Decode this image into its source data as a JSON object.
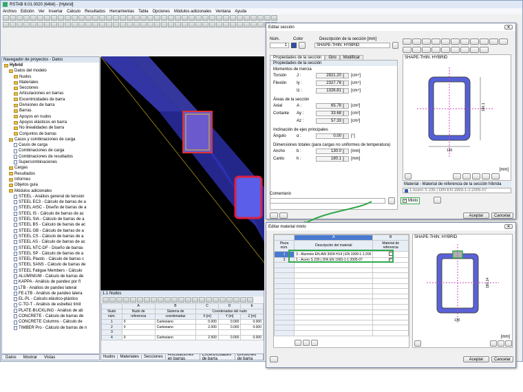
{
  "main_window": {
    "title": "RSTAB 8.01.0020 (64bit) - [Hybrid]",
    "menu": [
      "Archivo",
      "Edición",
      "Ver",
      "Insertar",
      "Cálculo",
      "Resultados",
      "Herramientas",
      "Tabla",
      "Opciones",
      "Módulos adicionales",
      "Ventana",
      "Ayuda"
    ]
  },
  "navigator": {
    "title": "Navegador de proyectos - Datos",
    "root": "Hybrid",
    "items": [
      {
        "label": "Datos del modelo",
        "level": 1,
        "kind": "folder"
      },
      {
        "label": "Nudos",
        "level": 2,
        "kind": "folder"
      },
      {
        "label": "Materiales",
        "level": 2,
        "kind": "folder"
      },
      {
        "label": "Secciones",
        "level": 2,
        "kind": "folder"
      },
      {
        "label": "Articulaciones en barras",
        "level": 2,
        "kind": "folder"
      },
      {
        "label": "Excentricidades de barra",
        "level": 2,
        "kind": "folder"
      },
      {
        "label": "Divisiones de barra",
        "level": 2,
        "kind": "folder"
      },
      {
        "label": "Barras",
        "level": 2,
        "kind": "folder"
      },
      {
        "label": "Apoyos en nudos",
        "level": 2,
        "kind": "folder"
      },
      {
        "label": "Apoyos elásticos en barra",
        "level": 2,
        "kind": "folder"
      },
      {
        "label": "No linealidades de barra",
        "level": 2,
        "kind": "folder"
      },
      {
        "label": "Conjuntos de barras",
        "level": 2,
        "kind": "folder"
      },
      {
        "label": "Casos y combinaciones de carga",
        "level": 1,
        "kind": "folder"
      },
      {
        "label": "Casos de carga",
        "level": 2,
        "kind": "doc"
      },
      {
        "label": "Combinaciones de carga",
        "level": 2,
        "kind": "doc"
      },
      {
        "label": "Combinaciones de resultados",
        "level": 2,
        "kind": "doc"
      },
      {
        "label": "Supercombinaciones",
        "level": 2,
        "kind": "doc"
      },
      {
        "label": "Cargas",
        "level": 1,
        "kind": "folder"
      },
      {
        "label": "Resultados",
        "level": 1,
        "kind": "folder"
      },
      {
        "label": "Informes",
        "level": 1,
        "kind": "folder"
      },
      {
        "label": "Objetos guía",
        "level": 1,
        "kind": "folder"
      },
      {
        "label": "Módulos adicionales",
        "level": 1,
        "kind": "folder"
      },
      {
        "label": "STEEL - Análisis general de tension",
        "level": 2,
        "kind": "doc"
      },
      {
        "label": "STEEL EC3 - Cálculo de barras de a",
        "level": 2,
        "kind": "doc"
      },
      {
        "label": "STEEL AISC - Diseño de barras de a",
        "level": 2,
        "kind": "doc"
      },
      {
        "label": "STEEL IS - Cálculo de barras de ac",
        "level": 2,
        "kind": "doc"
      },
      {
        "label": "STEEL SIA - Cálculo de barras de a",
        "level": 2,
        "kind": "doc"
      },
      {
        "label": "STEEL BS - Cálculo de barras de ac",
        "level": 2,
        "kind": "doc"
      },
      {
        "label": "STEEL GB - Cálculo de barras de a",
        "level": 2,
        "kind": "doc"
      },
      {
        "label": "STEEL CS - Cálculo de barras de a",
        "level": 2,
        "kind": "doc"
      },
      {
        "label": "STEEL AS - Cálculo de barras de ac",
        "level": 2,
        "kind": "doc"
      },
      {
        "label": "STEEL NTC-DF - Diseño de barras",
        "level": 2,
        "kind": "doc"
      },
      {
        "label": "STEEL SP - Cálculo de barras de a",
        "level": 2,
        "kind": "doc"
      },
      {
        "label": "STEEL Plastic - Cálculo de barras c",
        "level": 2,
        "kind": "doc"
      },
      {
        "label": "STEEL SANS - Cálculo de barras de",
        "level": 2,
        "kind": "doc"
      },
      {
        "label": "STEEL Fatigue Members - Cálculo",
        "level": 2,
        "kind": "doc"
      },
      {
        "label": "ALUMINIUM - Cálculo de barras de",
        "level": 2,
        "kind": "doc"
      },
      {
        "label": "KAPPA - Análisis de pandeo por fl",
        "level": 2,
        "kind": "doc"
      },
      {
        "label": "LTB - Análisis de pandeo lateral",
        "level": 2,
        "kind": "doc"
      },
      {
        "label": "FE-LTB - Análisis de pandeo latera",
        "level": 2,
        "kind": "doc"
      },
      {
        "label": "EL-PL - Cálculo elástico-plástico",
        "level": 2,
        "kind": "doc"
      },
      {
        "label": "C-TO-T - Análisis de esbeltez limit",
        "level": 2,
        "kind": "doc"
      },
      {
        "label": "PLATE-BUCKLING - Análisis de ab",
        "level": 2,
        "kind": "doc"
      },
      {
        "label": "CONCRETE - Cálculo de barras de",
        "level": 2,
        "kind": "doc"
      },
      {
        "label": "CONCRETE Columns - Cálculo de",
        "level": 2,
        "kind": "doc"
      },
      {
        "label": "TIMBER Pro - Cálculo de barras de n",
        "level": 2,
        "kind": "doc"
      }
    ],
    "tabs": [
      "Datos",
      "Mostrar",
      "Vistas"
    ]
  },
  "table_panel": {
    "title": "1.1 Nudos",
    "headers_letters": [
      "A",
      "B",
      "C",
      "D",
      "E"
    ],
    "headers_row1": [
      "Nudo",
      "Nudo de",
      "Sistema de",
      "Coordenadas del nudo",
      "",
      ""
    ],
    "headers_row2": [
      "núm.",
      "referencia",
      "coordenadas",
      "X [m]",
      "Y [m]",
      "Z [m]"
    ],
    "rows": [
      [
        "1",
        "0",
        "Cartesiano",
        "0.000",
        "0.000",
        "0.000"
      ],
      [
        "2",
        "0",
        "Cartesiano",
        "2.000",
        "0.000",
        "0.000"
      ],
      [
        "3",
        "",
        "",
        "",
        "",
        ""
      ],
      [
        "4",
        "0",
        "Cartesiano",
        "2.500",
        "0.000",
        "0.000"
      ]
    ],
    "tabs": [
      "Nudos",
      "Materiales",
      "Secciones",
      "Articulaciones en barras",
      "Excentricidades de barra",
      "Divisiones de barra"
    ]
  },
  "section_dialog": {
    "title": "Editar sección",
    "num_label": "Núm.",
    "color_label": "Color",
    "desc_label": "Descripción de la sección [mm]",
    "num": "1",
    "desc": "SHAPE-THIN: HYBRID",
    "tabs": [
      "Propiedades de la sección",
      "Giro",
      "Modificar"
    ],
    "props_title": "Propiedades de la sección",
    "inertia_title": "Momentos de inercia",
    "torsion_label": "Torsión",
    "torsion_sym": "J :",
    "torsion_val": "2821.20",
    "torsion_unit": "[cm⁴]",
    "flex_label": "Flexión",
    "iy_sym": "Iy :",
    "iy_val": "2327.78",
    "iy_unit": "[cm⁴]",
    "iz_sym": "Iz :",
    "iz_val": "1326.81",
    "iz_unit": "[cm⁴]",
    "area_title": "Áreas de la sección",
    "axial_label": "Axial",
    "a_sym": "A :",
    "a_val": "65.78",
    "a_unit": "[cm²]",
    "shear_label": "Cortante",
    "ay_sym": "Ay :",
    "ay_val": "33.68",
    "ay_unit": "[cm²]",
    "az_sym": "Az :",
    "az_val": "57.33",
    "az_unit": "[cm²]",
    "incl_title": "Inclinación de ejes principales",
    "angle_label": "Ángulo",
    "angle_sym": "α :",
    "angle_val": "0.00",
    "angle_unit": "[°]",
    "dims_title": "Dimensiones totales (para cargas no uniformes de temperatura)",
    "width_label": "Ancho",
    "width_sym": "b :",
    "width_val": "130.0",
    "width_unit": "[mm]",
    "height_label": "Canto",
    "height_sym": "h :",
    "height_val": "180.1",
    "height_unit": "[mm]",
    "comment_label": "Comentario",
    "mixed_label": "Mixto",
    "preview_title": "SHAPE-THIN: HYBRID",
    "dim_w": "130",
    "dim_h": "180.1",
    "unit_mm": "[mm]",
    "material_title": "Material - Material de referencia de la sección híbrida",
    "material_val": "1 Acero S 235 | DIN EN 1993-1-1:2005-07",
    "accept": "Aceptar",
    "cancel": "Cancelar"
  },
  "material_dialog": {
    "title": "Editar material mixto",
    "col_letters": [
      "A",
      "B"
    ],
    "h_part": "Pieza núm.",
    "h_desc": "Descripción del material",
    "h_ref": "Material de referencia",
    "rows": [
      {
        "num": "1",
        "desc": "3 - Aluminio EN-AW 3004 H14 | EN 1999-1-1:200",
        "ref": false
      },
      {
        "num": "2",
        "desc": "1 - Acero S 235 | DIN EN 1993-1-1:2005-07",
        "ref": true
      }
    ],
    "preview_title": "SHAPE-THIN: HYBRID",
    "dim_w": "130",
    "dim_h": "180.14",
    "unit_mm": "[mm]",
    "accept": "Aceptar",
    "cancel": "Cancelar"
  }
}
